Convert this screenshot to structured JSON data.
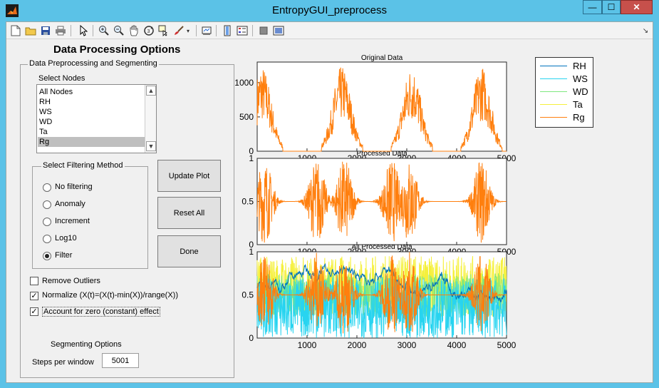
{
  "window": {
    "title": "EntropyGUI_preprocess",
    "min_glyph": "—",
    "max_glyph": "☐",
    "close_glyph": "✕"
  },
  "toolbar": {
    "icons": [
      "new-file-icon",
      "open-folder-icon",
      "save-icon",
      "print-icon",
      "pointer-icon",
      "zoom-in-icon",
      "zoom-out-icon",
      "pan-hand-icon",
      "rotate-3d-icon",
      "data-cursor-icon",
      "brush-icon",
      "link-icon",
      "colorbar-icon",
      "legend-icon",
      "hide-plot-tools-icon",
      "show-plot-tools-icon"
    ],
    "overflow_glyph": "↘"
  },
  "main": {
    "heading": "Data Processing Options",
    "preprocess_panel_title": "Data Preprocessing and Segmenting",
    "select_nodes_label": "Select Nodes",
    "nodes": [
      "All Nodes",
      "RH",
      "WS",
      "WD",
      "Ta",
      "Rg"
    ],
    "selected_node": "Rg",
    "filter_panel_title": "Select Filtering Method",
    "filter_options": [
      "No filtering",
      "Anomaly",
      "Increment",
      "Log10",
      "Filter"
    ],
    "selected_filter": "Filter",
    "checkboxes": [
      {
        "label": "Remove Outliers",
        "checked": false
      },
      {
        "label": "Normalize (X(t)=(X(t)-min(X))/range(X))",
        "checked": true
      },
      {
        "label": "Account for zero (constant) effect",
        "checked": true
      }
    ],
    "segmenting_label": "Segmenting Options",
    "steps_label": "Steps per window",
    "steps_value": "5001",
    "buttons": {
      "update": "Update Plot",
      "reset": "Reset All",
      "done": "Done"
    }
  },
  "colors": {
    "RH": "#0072bd",
    "WS": "#28d4f0",
    "WD": "#7ee87e",
    "Ta": "#f5f03c",
    "Rg": "#ff7f0e"
  },
  "chart_data": [
    {
      "type": "line",
      "title": "Original Data",
      "xlim": [
        1,
        5000
      ],
      "ylim": [
        0,
        1300
      ],
      "xticks": [
        "1000",
        "2000",
        "3000",
        "4000",
        "5000"
      ],
      "yticks": [
        "0",
        "500",
        "1000"
      ],
      "series": [
        {
          "name": "Rg",
          "pattern": "daily-cycle",
          "peaks_at": [
            100,
            1700,
            3100,
            4500
          ],
          "peak_value": 1250
        }
      ]
    },
    {
      "type": "line",
      "title": "Processed Data",
      "xlim": [
        1,
        5000
      ],
      "ylim": [
        0,
        1
      ],
      "xticks": [
        "1000",
        "2000",
        "3000",
        "4000",
        "5000"
      ],
      "yticks": [
        "0",
        "0.5",
        "1"
      ],
      "series": [
        {
          "name": "Rg",
          "pattern": "filtered",
          "baseline": 0.5
        }
      ]
    },
    {
      "type": "line",
      "title": "All Processed Data",
      "xlim": [
        1,
        5000
      ],
      "ylim": [
        0,
        1
      ],
      "xticks": [
        "1000",
        "2000",
        "3000",
        "4000",
        "5000"
      ],
      "yticks": [
        "0",
        "0.5",
        "1"
      ],
      "series": [
        {
          "name": "RH",
          "baseline": 0.6
        },
        {
          "name": "WS",
          "baseline": 0.35
        },
        {
          "name": "WD",
          "baseline": 0.5
        },
        {
          "name": "Ta",
          "baseline": 0.6
        },
        {
          "name": "Rg",
          "baseline": 0.5
        }
      ]
    }
  ],
  "legend": [
    "RH",
    "WS",
    "WD",
    "Ta",
    "Rg"
  ]
}
